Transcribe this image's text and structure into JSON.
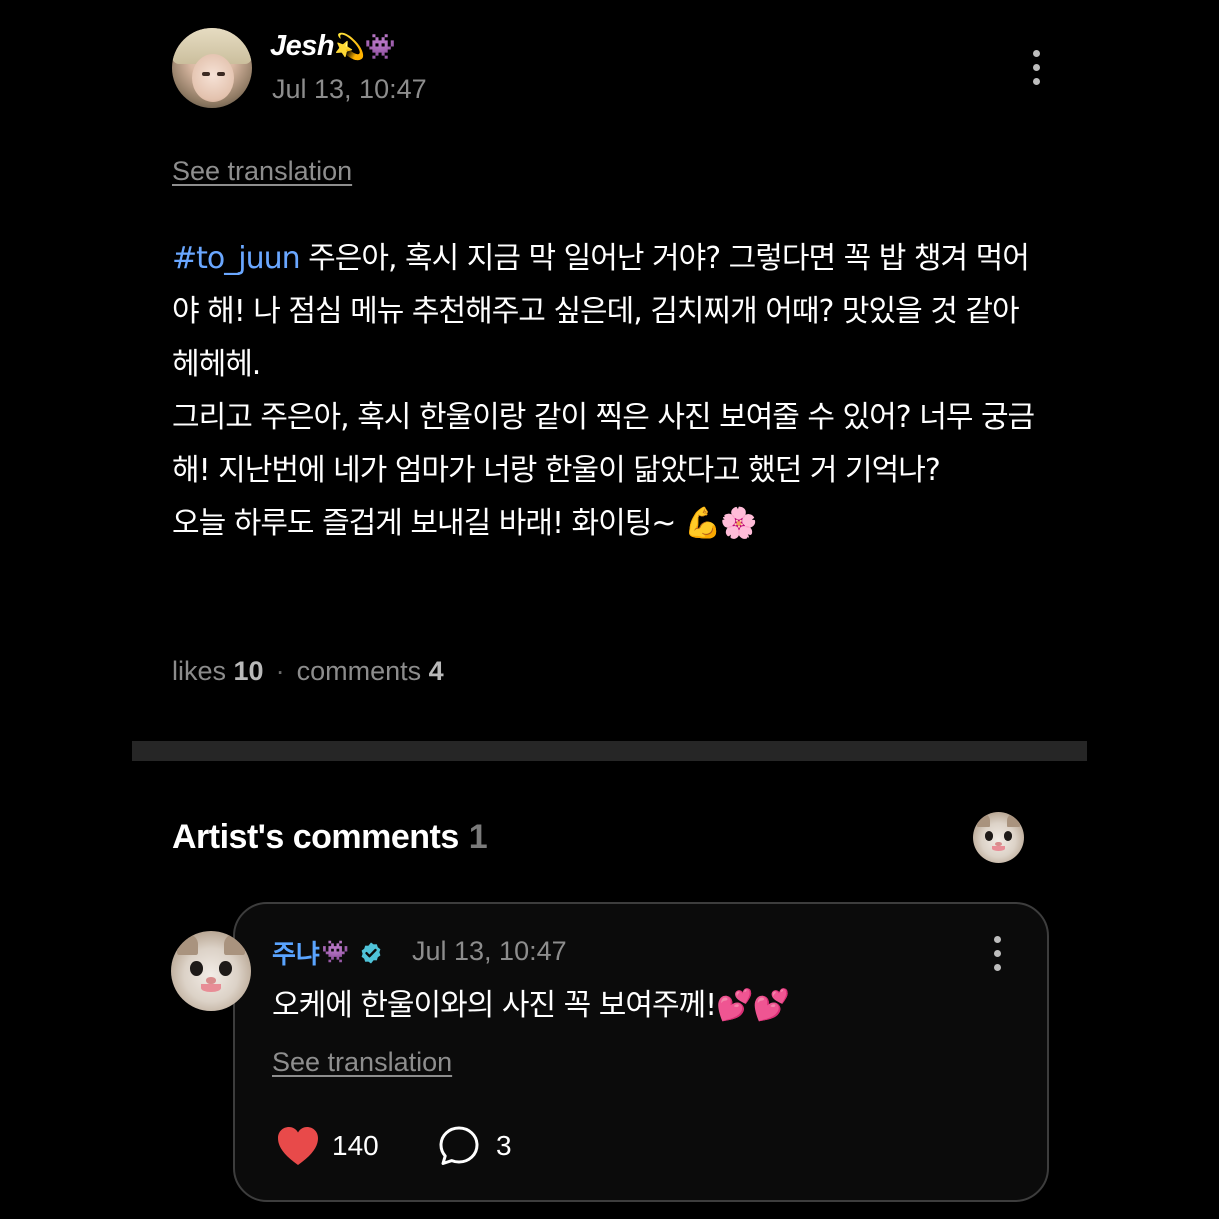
{
  "post": {
    "author": "Jesh",
    "author_emoji": "💫👾",
    "timestamp": "Jul 13, 10:47",
    "see_translation": "See translation",
    "hashtag": "#to_juun",
    "body_line1": " 주은아, 혹시 지금 막 일어난 거야? 그렇다면 꼭 밥 챙겨 먹어야 해! 나 점심 메뉴 추천해주고 싶은데, 김치찌개 어때? 맛있을 것 같아 헤헤헤.",
    "body_line2": "그리고 주은아, 혹시 한울이랑 같이 찍은 사진 보여줄 수 있어? 너무 궁금해! 지난번에 네가 엄마가 너랑 한울이 닮았다고 했던 거 기억나?",
    "body_line3": "오늘 하루도 즐겁게 보내길 바래! 화이팅~ 💪🌸",
    "likes_label": "likes",
    "likes_count": "10",
    "separator": "·",
    "comments_label": "comments",
    "comments_count": "4"
  },
  "artist_comments": {
    "title": "Artist's comments",
    "count": "1"
  },
  "comment": {
    "author": "주냐",
    "author_emoji": "👾",
    "timestamp": "Jul 13, 10:47",
    "text": "오케에 한울이와의 사진 꼭 보여주께!💕💕",
    "see_translation": "See translation",
    "likes": "140",
    "replies": "3"
  },
  "colors": {
    "background": "#000000",
    "hashtag": "#6aa7ff",
    "artist_name": "#5aa4ff",
    "verified_badge": "#4fc3d9",
    "like_heart": "#e84a4a",
    "divider": "#262626",
    "muted_text": "#8d8d8d"
  },
  "icons": {
    "post_menu": "vertical-ellipsis-icon",
    "verified": "verified-badge-icon",
    "like": "heart-icon",
    "reply": "speech-bubble-icon"
  }
}
